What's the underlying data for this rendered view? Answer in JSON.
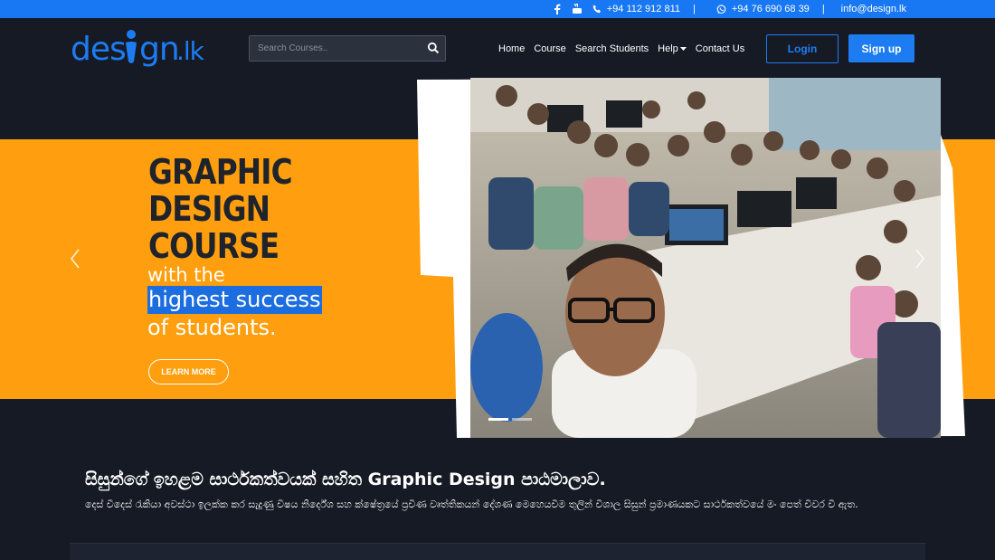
{
  "topbar": {
    "phone": "+94 112 912 811",
    "separator": "|",
    "whatsapp": "+94 76 690 68 39",
    "email": "info@design.lk",
    "icons": [
      "facebook-icon",
      "youtube-icon",
      "phone-icon",
      "whatsapp-icon"
    ]
  },
  "header": {
    "logo_text": "designlk",
    "search_placeholder": "Search Courses..",
    "nav": [
      "Home",
      "Course",
      "Search Students",
      "Help",
      "Contact Us"
    ],
    "login_label": "Login",
    "signup_label": "Sign up"
  },
  "hero": {
    "title_lines": [
      "GRAPHIC",
      "DESIGN",
      "COURSE"
    ],
    "sub_line1": "with the",
    "sub_highlight": "highest success",
    "sub_line3": "of students.",
    "cta_label": "LEARN MORE",
    "slide_count": 2,
    "active_slide": 1
  },
  "section": {
    "title": "සිසුන්ගේ ඉහළම සාර්ථකත්වයක් සහිත Graphic Design පාඨමාලාව.",
    "text": "දෙස් වීදෙස් රැකියා අවස්ථා ඉලක්ක කර සැදුණු විෂය නිර්දේශ සහ ක්ෂේත්‍රයේ ප්‍රවීණ වෘත්තිකයන් දේශණ මෙහෙයවීම තුලින් විශාල සිසුන් ප්‍රමාණයකට සාර්ථකත්වයේ මං පෙත් විවර වී ඇත."
  },
  "colors": {
    "topbar": "#1877f2",
    "background": "#151a24",
    "hero_band": "#ff9f0f",
    "accent": "#1e7cf2"
  }
}
